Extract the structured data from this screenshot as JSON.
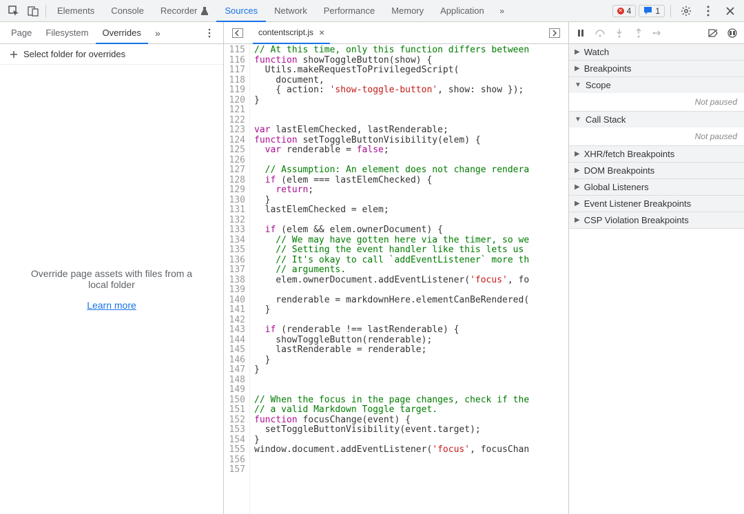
{
  "toolbar": {
    "tabs": [
      "Elements",
      "Console",
      "Recorder",
      "Sources",
      "Network",
      "Performance",
      "Memory",
      "Application"
    ],
    "active": "Sources",
    "errors": "4",
    "messages": "1"
  },
  "left": {
    "tabs": [
      "Page",
      "Filesystem",
      "Overrides"
    ],
    "active": "Overrides",
    "select_folder": "Select folder for overrides",
    "empty_text": "Override page assets with files from a local folder",
    "learn_more": "Learn more"
  },
  "center": {
    "filename": "contentscript.js",
    "first_line": 115,
    "lines": [
      "// At this time, only this function differs between",
      "function showToggleButton(show) {",
      "  Utils.makeRequestToPrivilegedScript(",
      "    document,",
      "    { action: 'show-toggle-button', show: show });",
      "}",
      "",
      "",
      "var lastElemChecked, lastRenderable;",
      "function setToggleButtonVisibility(elem) {",
      "  var renderable = false;",
      "",
      "  // Assumption: An element does not change rendera",
      "  if (elem === lastElemChecked) {",
      "    return;",
      "  }",
      "  lastElemChecked = elem;",
      "",
      "  if (elem && elem.ownerDocument) {",
      "    // We may have gotten here via the timer, so we",
      "    // Setting the event handler like this lets us ",
      "    // It's okay to call `addEventListener` more th",
      "    // arguments.",
      "    elem.ownerDocument.addEventListener('focus', fo",
      "",
      "    renderable = markdownHere.elementCanBeRendered(",
      "  }",
      "",
      "  if (renderable !== lastRenderable) {",
      "    showToggleButton(renderable);",
      "    lastRenderable = renderable;",
      "  }",
      "}",
      "",
      "",
      "// When the focus in the page changes, check if the",
      "// a valid Markdown Toggle target.",
      "function focusChange(event) {",
      "  setToggleButtonVisibility(event.target);",
      "}",
      "window.document.addEventListener('focus', focusChan",
      "",
      ""
    ]
  },
  "right": {
    "sections": {
      "watch": "Watch",
      "breakpoints": "Breakpoints",
      "scope": "Scope",
      "callstack": "Call Stack",
      "xhr": "XHR/fetch Breakpoints",
      "dom": "DOM Breakpoints",
      "global": "Global Listeners",
      "event": "Event Listener Breakpoints",
      "csp": "CSP Violation Breakpoints"
    },
    "not_paused": "Not paused"
  }
}
